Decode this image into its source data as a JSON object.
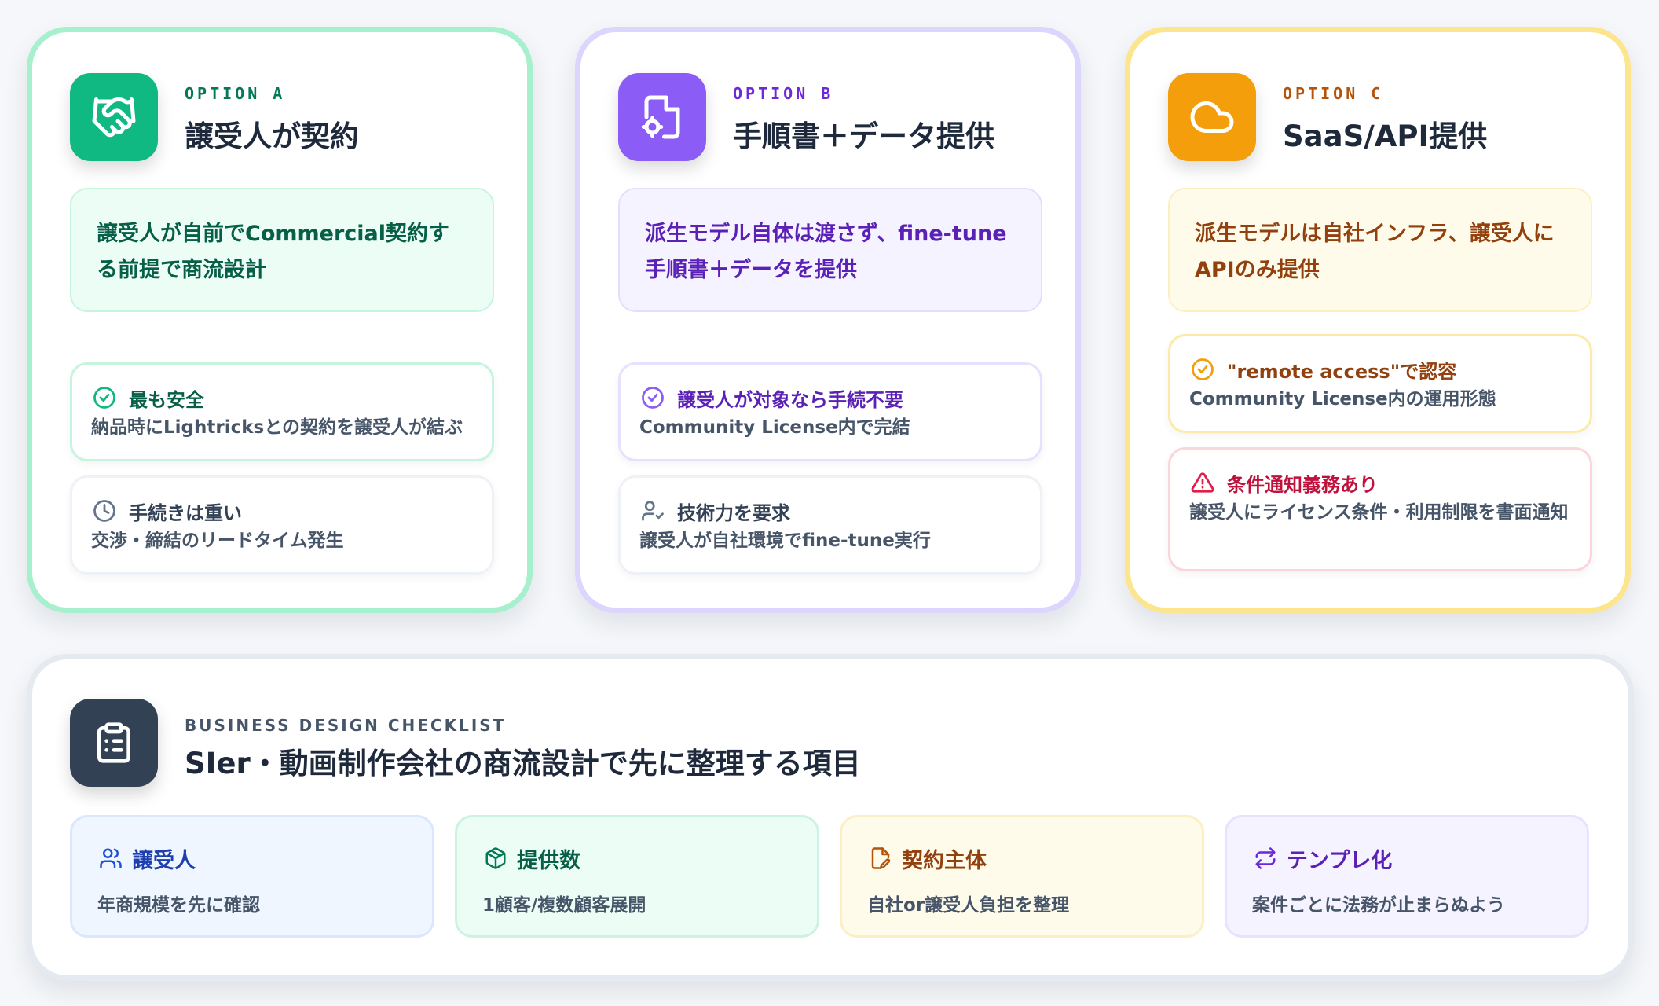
{
  "options": [
    {
      "label": "OPTION A",
      "title": "譲受人が契約",
      "icon": "handshake-icon",
      "accent": "#10b981",
      "summary": "譲受人が自前でCommercial契約する前提で商流設計",
      "points": [
        {
          "icon": "check-circle-icon",
          "title": "最も安全",
          "body": "納品時にLightricksとの契約を譲受人が結ぶ"
        },
        {
          "icon": "clock-icon",
          "title": "手続きは重い",
          "body": "交渉・締結のリードタイム発生"
        }
      ]
    },
    {
      "label": "OPTION B",
      "title": "手順書＋データ提供",
      "icon": "file-settings-icon",
      "accent": "#8b5cf6",
      "summary": "派生モデル自体は渡さず、fine-tune手順書＋データを提供",
      "points": [
        {
          "icon": "check-circle-icon",
          "title": "譲受人が対象なら手続不要",
          "body": "Community License内で完結"
        },
        {
          "icon": "user-check-icon",
          "title": "技術力を要求",
          "body": "譲受人が自社環境でfine-tune実行"
        }
      ]
    },
    {
      "label": "OPTION C",
      "title": "SaaS/API提供",
      "icon": "cloud-icon",
      "accent": "#f59e0b",
      "summary": "派生モデルは自社インフラ、譲受人にAPIのみ提供",
      "points": [
        {
          "icon": "check-circle-icon",
          "title": "\"remote access\"で認容",
          "body": "Community License内の運用形態"
        },
        {
          "icon": "warning-icon",
          "title": "条件通知義務あり",
          "body": "譲受人にライセンス条件・利用制限を書面通知"
        }
      ]
    }
  ],
  "checklist": {
    "label": "BUSINESS DESIGN CHECKLIST",
    "title": "SIer・動画制作会社の商流設計で先に整理する項目",
    "icon": "clipboard-icon",
    "items": [
      {
        "icon": "users-icon",
        "title": "譲受人",
        "body": "年商規模を先に確認"
      },
      {
        "icon": "package-icon",
        "title": "提供数",
        "body": "1顧客/複数顧客展開"
      },
      {
        "icon": "file-edit-icon",
        "title": "契約主体",
        "body": "自社or譲受人負担を整理"
      },
      {
        "icon": "repeat-icon",
        "title": "テンプレ化",
        "body": "案件ごとに法務が止まらぬよう"
      }
    ]
  }
}
